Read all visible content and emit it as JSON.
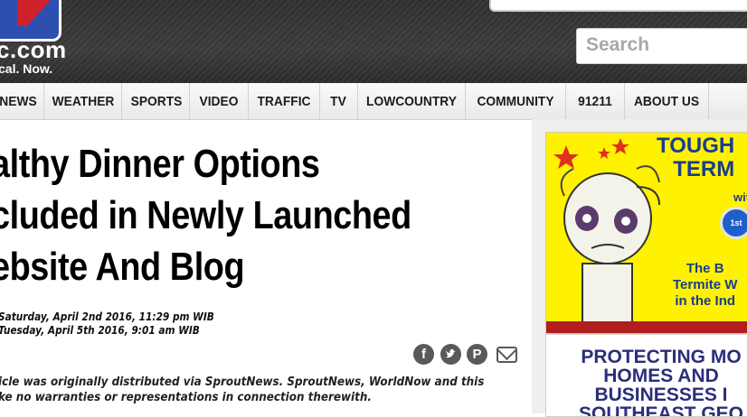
{
  "header": {
    "logo_text": "c.com",
    "tagline": "cal. Now.",
    "search_placeholder": "Search"
  },
  "nav": {
    "items": [
      "NEWS",
      "WEATHER",
      "SPORTS",
      "VIDEO",
      "TRAFFIC",
      "TV",
      "LOWCOUNTRY",
      "COMMUNITY",
      "91211",
      "ABOUT US"
    ]
  },
  "article": {
    "headline_lines": [
      "althy Dinner Options",
      "cluded in Newly Launched",
      "ebsite And Blog"
    ],
    "posted": "Saturday, April 2nd 2016, 11:29 pm WIB",
    "updated": "Tuesday, April 5th 2016, 9:01 am WIB",
    "share_icons": [
      "facebook-icon",
      "twitter-icon",
      "pinterest-icon",
      "email-icon"
    ],
    "disclaimer_lines": [
      "icle was originally distributed via SproutNews. SproutNews, WorldNow and this",
      "ke no warranties or representations in connection therewith."
    ]
  },
  "ads": {
    "ad1": {
      "title_lines": [
        "TOUGH",
        "TERM"
      ],
      "with": "with",
      "ribbon": "1st",
      "sub_lines": [
        "The B",
        "Termite W",
        "in the Ind"
      ]
    },
    "ad2": {
      "lines": [
        "PROTECTING MO",
        "HOMES AND",
        "BUSINESSES I",
        "SOUTHEAST GEO"
      ]
    }
  }
}
